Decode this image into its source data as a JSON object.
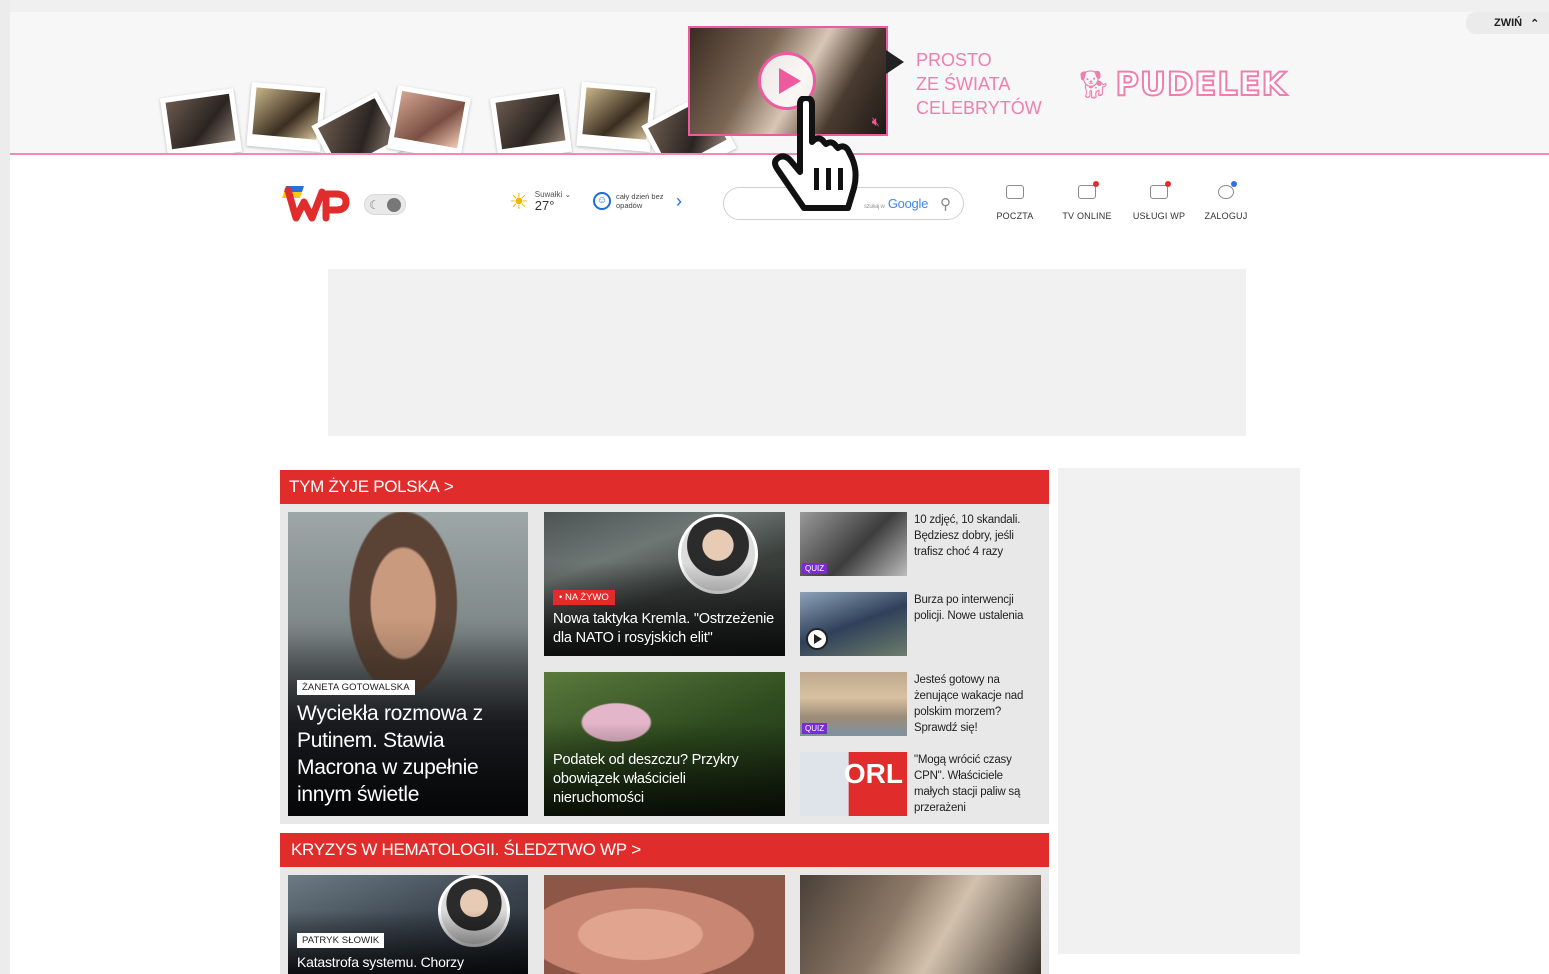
{
  "banner": {
    "collapse_label": "ZWIŃ",
    "tagline_line1": "PROSTO",
    "tagline_line2": "ZE ŚWIATA",
    "tagline_line3": "CELEBRYTÓW",
    "brand": "PUDELEK",
    "accent_color": "#ee7fae"
  },
  "header": {
    "weather": {
      "city": "Suwałki",
      "temperature": "27°",
      "icon": "sun-icon"
    },
    "forecast": {
      "text": "cały dzień bez opadów",
      "icon": "smile-icon"
    },
    "search": {
      "placeholder": "",
      "engine_label": "Google",
      "engine_prefix": "szukaj w"
    },
    "nav": [
      {
        "label": "POCZTA",
        "icon": "mail-icon"
      },
      {
        "label": "TV ONLINE",
        "icon": "tv-icon"
      },
      {
        "label": "USŁUGI WP",
        "icon": "services-icon"
      },
      {
        "label": "ZALOGUJ",
        "icon": "user-icon"
      }
    ]
  },
  "sections": [
    {
      "title": "TYM ŻYJE POLSKA",
      "chevron": ">",
      "lead": {
        "author": "ŻANETA GOTOWALSKA",
        "title": "Wyciekła rozmowa z Putinem. Stawia Macrona w zupełnie innym świetle"
      },
      "middle": [
        {
          "tag": "• NA ŻYWO",
          "title": "Nowa taktyka Kremla. \"Ostrzeżenie dla NATO i rosyjskich elit\""
        },
        {
          "title": "Podatek od deszczu? Przykry obowiązek właścicieli nieruchomości"
        }
      ],
      "side": [
        {
          "title": "10 zdjęć, 10 skandali. Będziesz dobry, jeśli trafisz choć 4 razy",
          "tag": "QUIZ"
        },
        {
          "title": "Burza po interwencji policji. Nowe ustalenia",
          "video": true
        },
        {
          "title": "Jesteś gotowy na żenujące wakacje nad polskim morzem? Sprawdź się!",
          "tag": "QUIZ"
        },
        {
          "title": "\"Mogą wrócić czasy CPN\". Właściciele małych stacji paliw są przerażeni",
          "thumb_text": "ORL"
        }
      ]
    },
    {
      "title": "KRYZYS W HEMATOLOGII. ŚLEDZTWO WP",
      "chevron": ">",
      "lead": {
        "author": "PATRYK SŁOWIK",
        "title": "Katastrofa systemu. Chorzy"
      }
    }
  ],
  "colors": {
    "brand_red": "#e12c2c",
    "quiz_purple": "#7b2bd6",
    "banner_pink": "#ee5aa0"
  }
}
